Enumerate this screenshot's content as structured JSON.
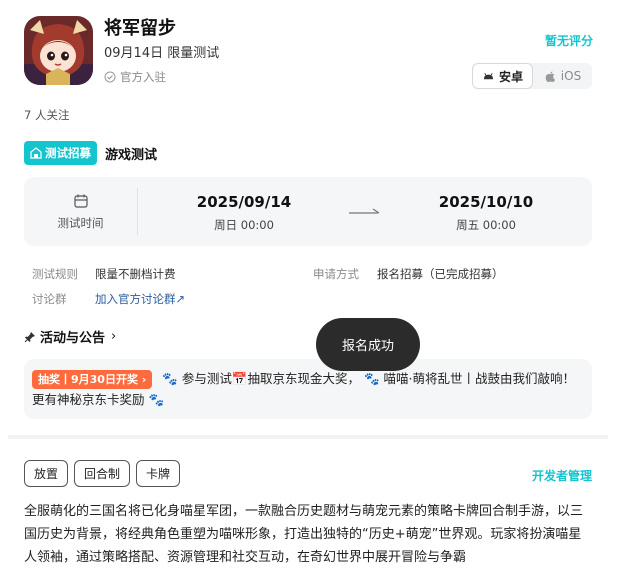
{
  "game": {
    "title": "将军留步",
    "test_date": "09月14日 限量测试",
    "official": "官方入驻",
    "rating": "暂无评分",
    "followers": "7 人关注"
  },
  "platforms": [
    {
      "label": "安卓",
      "icon": "android-icon",
      "active": true
    },
    {
      "label": "iOS",
      "icon": "apple-icon",
      "active": false
    }
  ],
  "test": {
    "badge": "测试招募",
    "title": "游戏测试",
    "time_label": "测试时间",
    "start_date": "2025/09/14",
    "start_week": "周日 00:00",
    "end_date": "2025/10/10",
    "end_week": "周五 00:00"
  },
  "info": {
    "rule_label": "测试规则",
    "rule_value": "限量不删档计费",
    "apply_label": "申请方式",
    "apply_value": "报名招募（已完成招募）",
    "group_label": "讨论群",
    "group_link": "加入官方讨论群↗"
  },
  "activity": {
    "section_title": "活动与公告",
    "tag": "抽奖丨9月30日开奖 ›",
    "text_1": "参与测试",
    "text_2": "抽取京东现金大奖，",
    "text_3": "喵喵·萌将乱世丨战鼓由我们敲响！更有神秘京东卡奖励"
  },
  "toast": "报名成功",
  "tags": [
    "放置",
    "回合制",
    "卡牌"
  ],
  "dev_manage": "开发者管理",
  "description": "全服萌化的三国名将已化身喵星军团，一款融合历史题材与萌宠元素的策略卡牌回合制手游，以三国历史为背景，将经典角色重塑为喵咪形象，打造出独特的“历史+萌宠”世界观。玩家将扮演喵星人领袖，通过策略搭配、资源管理和社交互动，在奇幻世界中展开冒险与争霸",
  "colors": {
    "accent": "#15c5ce",
    "tag_orange": "#ff6b3d",
    "link": "#2a5d9f"
  }
}
